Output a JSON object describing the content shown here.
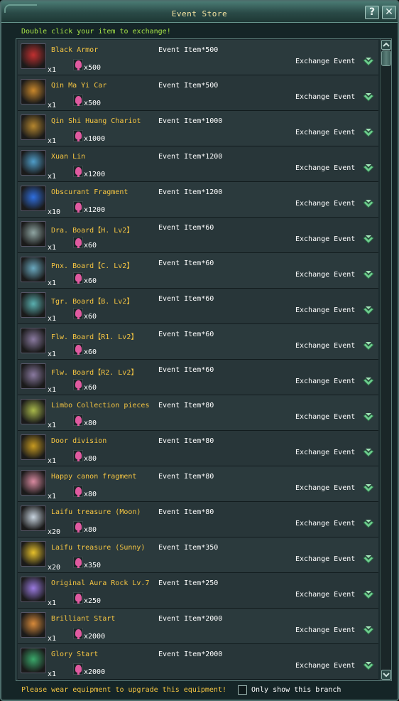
{
  "window": {
    "title": "Event Store",
    "help_label": "?",
    "close_label": "✕"
  },
  "hint": "Double click your item to exchange!",
  "items": [
    {
      "name": "Black Armor",
      "qty": "x1",
      "cost": "x500",
      "event_cost": "Event Item*500",
      "exchange_label": "Exchange Event",
      "icon": "armor-icon",
      "color": "#c23030"
    },
    {
      "name": "Qin Ma Yi Car",
      "qty": "x1",
      "cost": "x500",
      "event_cost": "Event Item*500",
      "exchange_label": "Exchange Event",
      "icon": "cart-icon",
      "color": "#c9872b"
    },
    {
      "name": "Qin Shi Huang Chariot",
      "qty": "x1",
      "cost": "x1000",
      "event_cost": "Event Item*1000",
      "exchange_label": "Exchange Event",
      "icon": "chariot-icon",
      "color": "#b5862e"
    },
    {
      "name": "Xuan Lin",
      "qty": "x1",
      "cost": "x1200",
      "event_cost": "Event Item*1200",
      "exchange_label": "Exchange Event",
      "icon": "spirit-icon",
      "color": "#4f9dc9"
    },
    {
      "name": "Obscurant Fragment",
      "qty": "x10",
      "cost": "x1200",
      "event_cost": "Event Item*1200",
      "exchange_label": "Exchange Event",
      "icon": "crystal-icon",
      "color": "#2f6fe0"
    },
    {
      "name": "Dra. Board【H. Lv2】",
      "qty": "x1",
      "cost": "x60",
      "event_cost": "Event Item*60",
      "exchange_label": "Exchange Event",
      "icon": "board-icon",
      "color": "#8fa5a2"
    },
    {
      "name": "Pnx. Board【C. Lv2】",
      "qty": "x1",
      "cost": "x60",
      "event_cost": "Event Item*60",
      "exchange_label": "Exchange Event",
      "icon": "board-icon",
      "color": "#6aa9c0"
    },
    {
      "name": "Tgr. Board【B. Lv2】",
      "qty": "x1",
      "cost": "x60",
      "event_cost": "Event Item*60",
      "exchange_label": "Exchange Event",
      "icon": "board-icon",
      "color": "#5ab0b0"
    },
    {
      "name": "Flw. Board【R1. Lv2】",
      "qty": "x1",
      "cost": "x60",
      "event_cost": "Event Item*60",
      "exchange_label": "Exchange Event",
      "icon": "board-icon",
      "color": "#8a7aa0"
    },
    {
      "name": "Flw. Board【R2. Lv2】",
      "qty": "x1",
      "cost": "x60",
      "event_cost": "Event Item*60",
      "exchange_label": "Exchange Event",
      "icon": "board-icon",
      "color": "#8a7aa0"
    },
    {
      "name": "Limbo Collection pieces",
      "qty": "x1",
      "cost": "x80",
      "event_cost": "Event Item*80",
      "exchange_label": "Exchange Event",
      "icon": "pieces-icon",
      "color": "#a8b84a"
    },
    {
      "name": "Door division",
      "qty": "x1",
      "cost": "x80",
      "event_cost": "Event Item*80",
      "exchange_label": "Exchange Event",
      "icon": "door-icon",
      "color": "#c79a20"
    },
    {
      "name": "Happy canon fragment",
      "qty": "x1",
      "cost": "x80",
      "event_cost": "Event Item*80",
      "exchange_label": "Exchange Event",
      "icon": "fragment-icon",
      "color": "#d98aa0"
    },
    {
      "name": "Laifu treasure (Moon)",
      "qty": "x20",
      "cost": "x80",
      "event_cost": "Event Item*80",
      "exchange_label": "Exchange Event",
      "icon": "scroll-icon",
      "color": "#c8d4df"
    },
    {
      "name": "Laifu treasure (Sunny)",
      "qty": "x20",
      "cost": "x350",
      "event_cost": "Event Item*350",
      "exchange_label": "Exchange Event",
      "icon": "scroll-icon",
      "color": "#e6c02a"
    },
    {
      "name": "Original Aura Rock Lv.7",
      "qty": "x1",
      "cost": "x250",
      "event_cost": "Event Item*250",
      "exchange_label": "Exchange Event",
      "icon": "orb-icon",
      "color": "#9a7ae0"
    },
    {
      "name": "Brilliant Start",
      "qty": "x1",
      "cost": "x2000",
      "event_cost": "Event Item*2000",
      "exchange_label": "Exchange Event",
      "icon": "ring-icon",
      "color": "#d88a3a"
    },
    {
      "name": "Glory Start",
      "qty": "x1",
      "cost": "x2000",
      "event_cost": "Event Item*2000",
      "exchange_label": "Exchange Event",
      "icon": "ring-icon",
      "color": "#3aa86a"
    }
  ],
  "footer": {
    "warning": "Please wear equipment to upgrade this equipment!",
    "branch_label": "Only show this branch"
  }
}
